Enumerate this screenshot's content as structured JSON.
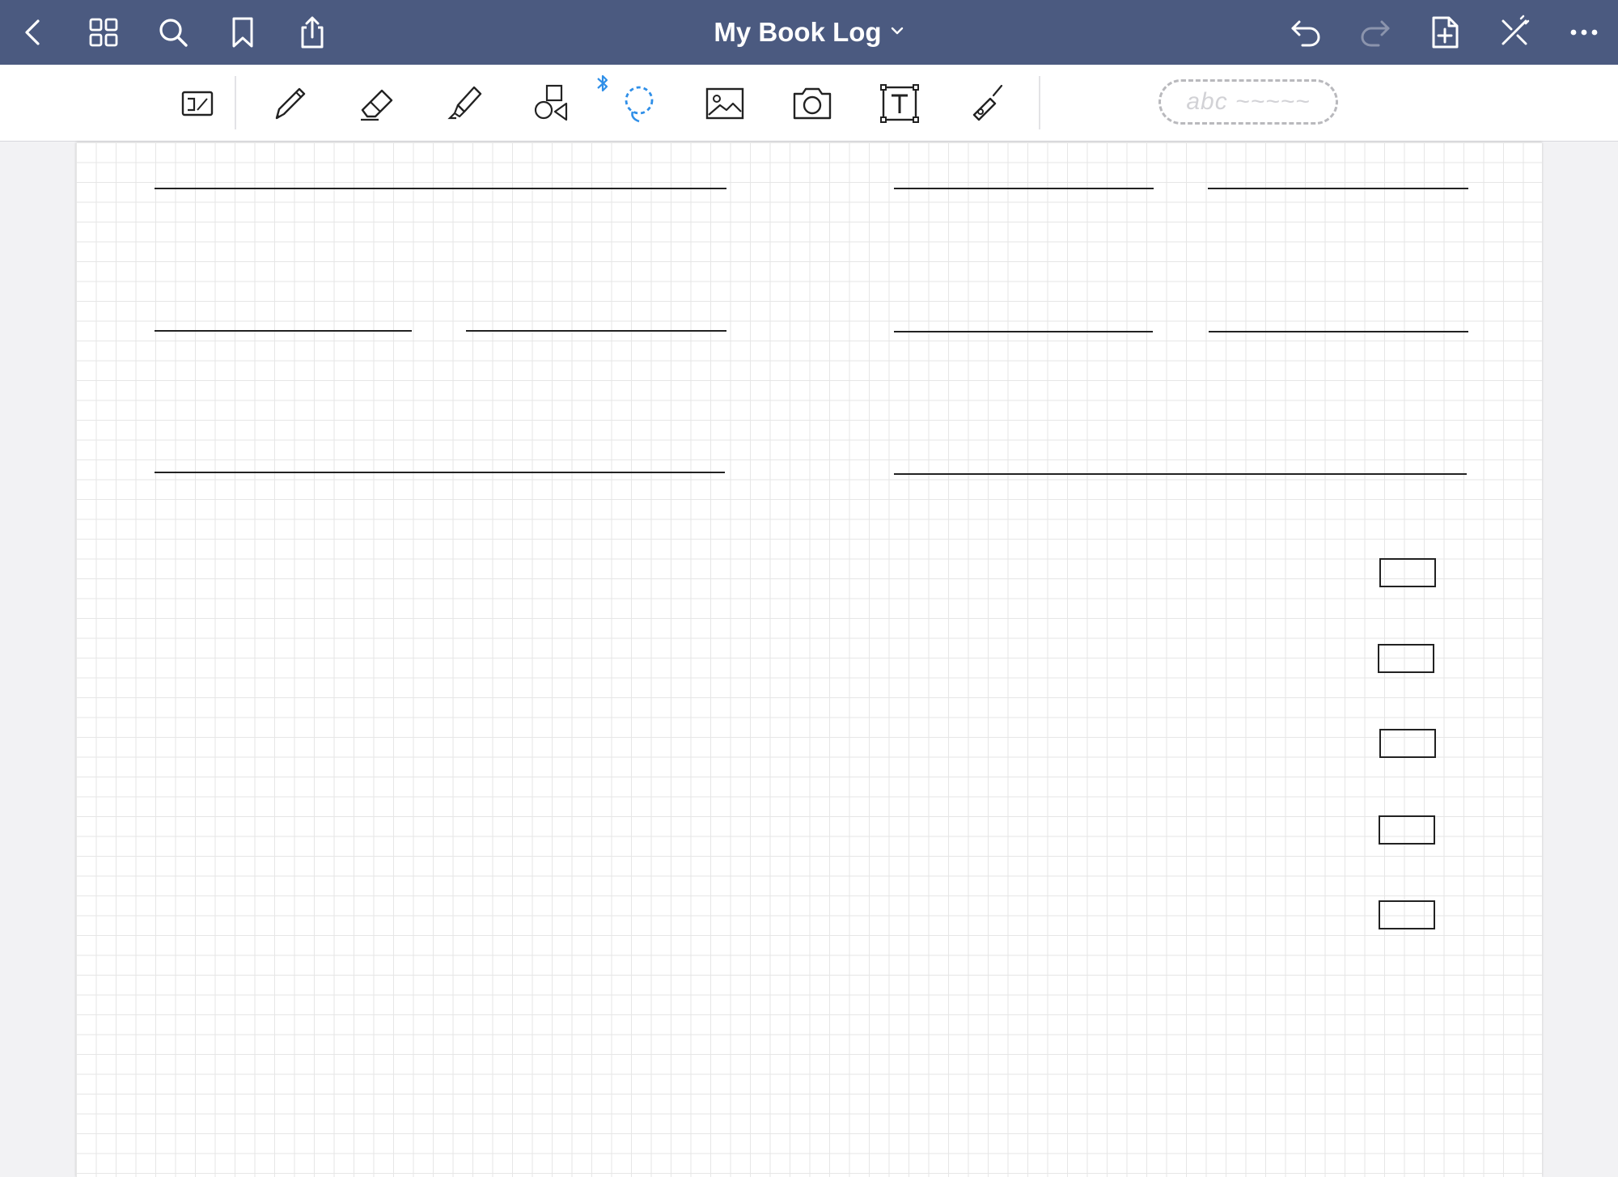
{
  "app": {
    "title": "My Book Log",
    "nav_color": "#4b5a80",
    "accent_color": "#2f8fe8"
  },
  "nav": {
    "left": [
      "back-icon",
      "grid-view-icon",
      "search-icon",
      "bookmark-icon",
      "share-icon"
    ],
    "right": [
      "undo-icon",
      "redo-icon",
      "add-page-icon",
      "pen-off-icon",
      "more-icon"
    ]
  },
  "toolbar": {
    "tools": [
      "read-mode-icon",
      "pen-icon",
      "eraser-icon",
      "highlighter-icon",
      "shapes-icon",
      "lasso-icon",
      "image-icon",
      "camera-icon",
      "text-box-icon",
      "laser-pointer-icon"
    ],
    "lasso_badge": "bluetooth-icon",
    "handwriting_preview": "abc ~~~~~"
  },
  "page": {
    "style": "grid",
    "line_color": "#222222",
    "form_lines": 10,
    "checkboxes": 5
  }
}
